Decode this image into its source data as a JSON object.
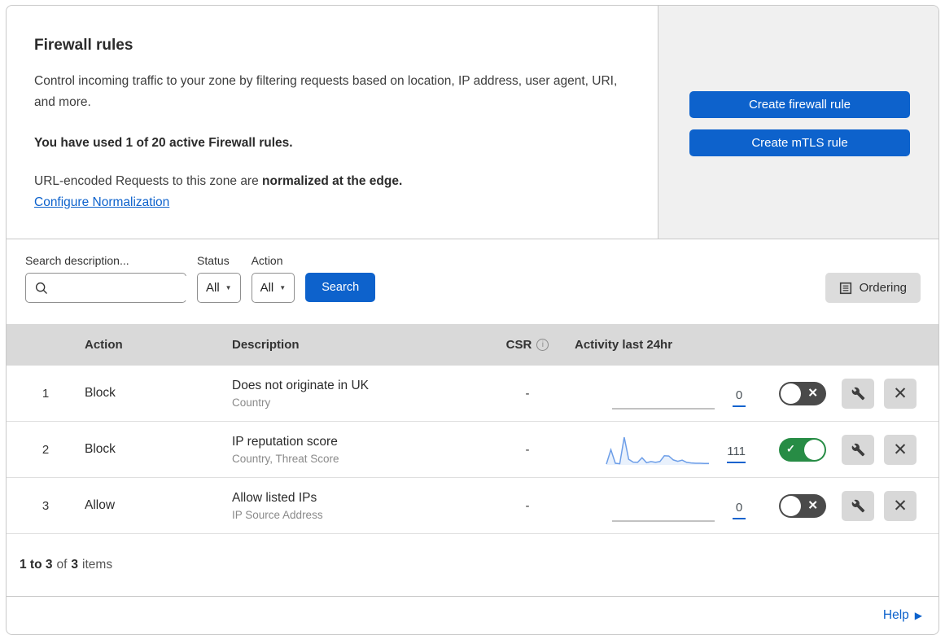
{
  "header": {
    "title": "Firewall rules",
    "description": "Control incoming traffic to your zone by filtering requests based on location, IP address, user agent, URI, and more.",
    "usage_line": "You have used 1 of 20 active Firewall rules.",
    "normalization_text": "URL-encoded Requests to this zone are",
    "normalization_bold": "normalized at the edge.",
    "normalization_link": "Configure Normalization",
    "create_firewall_button": "Create firewall rule",
    "create_mtls_button": "Create mTLS rule"
  },
  "filters": {
    "search_label": "Search description...",
    "status_label": "Status",
    "status_value": "All",
    "action_label": "Action",
    "action_value": "All",
    "search_button": "Search",
    "ordering_button": "Ordering"
  },
  "table": {
    "columns": {
      "action": "Action",
      "description": "Description",
      "csr": "CSR",
      "activity": "Activity last 24hr"
    },
    "rows": [
      {
        "index": "1",
        "action": "Block",
        "title": "Does not originate in UK",
        "subtitle": "Country",
        "csr": "-",
        "activity_count": "0",
        "enabled": false,
        "sparkline": []
      },
      {
        "index": "2",
        "action": "Block",
        "title": "IP reputation score",
        "subtitle": "Country, Threat Score",
        "csr": "-",
        "activity_count": "111",
        "enabled": true,
        "sparkline": [
          3,
          55,
          6,
          4,
          100,
          20,
          10,
          9,
          26,
          8,
          12,
          9,
          12,
          33,
          32,
          18,
          13,
          17,
          9,
          7,
          6,
          6,
          5,
          5
        ]
      },
      {
        "index": "3",
        "action": "Allow",
        "title": "Allow listed IPs",
        "subtitle": "IP Source Address",
        "csr": "-",
        "activity_count": "0",
        "enabled": false,
        "sparkline": []
      }
    ]
  },
  "chart_data": {
    "type": "line",
    "title": "Activity last 24hr sparkline (rule 2)",
    "x": [
      1,
      2,
      3,
      4,
      5,
      6,
      7,
      8,
      9,
      10,
      11,
      12,
      13,
      14,
      15,
      16,
      17,
      18,
      19,
      20,
      21,
      22,
      23,
      24
    ],
    "values": [
      3,
      55,
      6,
      4,
      100,
      20,
      10,
      9,
      26,
      8,
      12,
      9,
      12,
      33,
      32,
      18,
      13,
      17,
      9,
      7,
      6,
      6,
      5,
      5
    ],
    "total_label": "111",
    "xlabel": "",
    "ylabel": "",
    "grid": false
  },
  "footer": {
    "range_bold": "1 to 3",
    "of_text": "of",
    "total_bold": "3",
    "items_text": "items",
    "help_label": "Help"
  },
  "icons": {
    "info_glyph": "i",
    "dropdown_caret": "▼",
    "help_arrow": "▶",
    "toggle_on_glyph": "✓",
    "toggle_off_glyph": "✕",
    "close_glyph": "✕",
    "csr_dash": "-"
  },
  "colors": {
    "accent_blue": "#0d62cc",
    "toggle_on_green": "#278c45",
    "toggle_off_gray": "#4a4a4a",
    "table_header_gray": "#d9d9d9",
    "panel_gray": "#f0f0f0",
    "sparkline_blue": "#6d9ee8"
  }
}
